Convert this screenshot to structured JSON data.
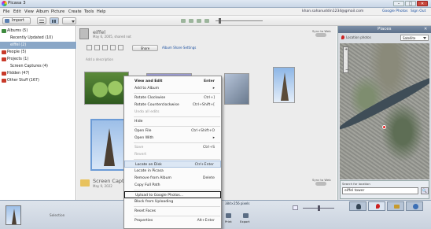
{
  "app": {
    "title": "Picasa 3"
  },
  "window_controls": {
    "minimize": "–",
    "maximize": "□",
    "close": "✕"
  },
  "menu": {
    "items": [
      "File",
      "Edit",
      "View",
      "Album",
      "Picture",
      "Create",
      "Tools",
      "Help"
    ],
    "account": "khan.sahanuddin1234@gmail.com",
    "links": [
      "Google Photos",
      "Sign Out"
    ]
  },
  "toolbar": {
    "import_label": "Import",
    "brand_hint": "Picasa"
  },
  "sidebar": {
    "items": [
      {
        "label": "Albums (5)",
        "type": "group",
        "color": "green"
      },
      {
        "label": "Recently Updated (10)",
        "type": "item"
      },
      {
        "label": "eiffel (2)",
        "type": "item",
        "selected": true
      },
      {
        "label": "People (5)",
        "type": "group",
        "color": "red"
      },
      {
        "label": "Projects (1)",
        "type": "group",
        "color": "red"
      },
      {
        "label": "Screen Captures (4)",
        "type": "item"
      },
      {
        "label": "Hidden (47)",
        "type": "group",
        "color": "red"
      },
      {
        "label": "Other Stuff (167)",
        "type": "group",
        "color": "red"
      }
    ]
  },
  "album": {
    "title": "eiffel",
    "date": "May 6, 2005, shared not",
    "add_description": "Add a description",
    "share_label": "Share",
    "upload_label": "Sync to Web",
    "share_options": "Album Share Settings"
  },
  "album2": {
    "title": "Screen Captures",
    "date": "May 9, 2022",
    "upload_label": "Sync to Web"
  },
  "context_menu": {
    "items": [
      {
        "label": "View and Edit",
        "shortcut": "Enter",
        "style": "bold"
      },
      {
        "label": "Add to Album",
        "shortcut": "▸"
      },
      {
        "sep": true
      },
      {
        "label": "Rotate Clockwise",
        "shortcut": "Ctrl+]"
      },
      {
        "label": "Rotate Counterclockwise",
        "shortcut": "Ctrl+Shift+["
      },
      {
        "label": "Undo all edits",
        "style": "dis"
      },
      {
        "sep": true
      },
      {
        "label": "Hide"
      },
      {
        "sep": true
      },
      {
        "label": "Open File",
        "shortcut": "Ctrl+Shift+O"
      },
      {
        "label": "Open With",
        "shortcut": "▸"
      },
      {
        "sep": true
      },
      {
        "label": "Save",
        "shortcut": "Ctrl+S",
        "style": "dis"
      },
      {
        "label": "Revert",
        "style": "dis"
      },
      {
        "sep": true
      },
      {
        "label": "Locate on Disk",
        "shortcut": "Ctrl+Enter",
        "style": "hl"
      },
      {
        "label": "Locate in Picasa"
      },
      {
        "label": "Remove from Album",
        "shortcut": "Delete"
      },
      {
        "label": "Copy Full Path"
      },
      {
        "sep": true
      },
      {
        "label": "Upload to Google Photos...",
        "style": "box"
      },
      {
        "label": "Block from Uploading"
      },
      {
        "sep": true
      },
      {
        "label": "Reset Faces"
      },
      {
        "sep": true
      },
      {
        "label": "Properties",
        "shortcut": "Alt+Enter"
      }
    ]
  },
  "places_panel": {
    "title": "Places",
    "close": "✕",
    "search_placeholder": "Location photos",
    "map_type": "Satellite",
    "result_text": "Search for location",
    "search_label": "Search for location",
    "search_value": "eiffel tower",
    "go_label": "🔍"
  },
  "status": {
    "selection": "Selection",
    "pixels": "384×256 pixels",
    "info": "Print • Export"
  },
  "bottom": {
    "actions": [
      "Print",
      "Export"
    ]
  }
}
